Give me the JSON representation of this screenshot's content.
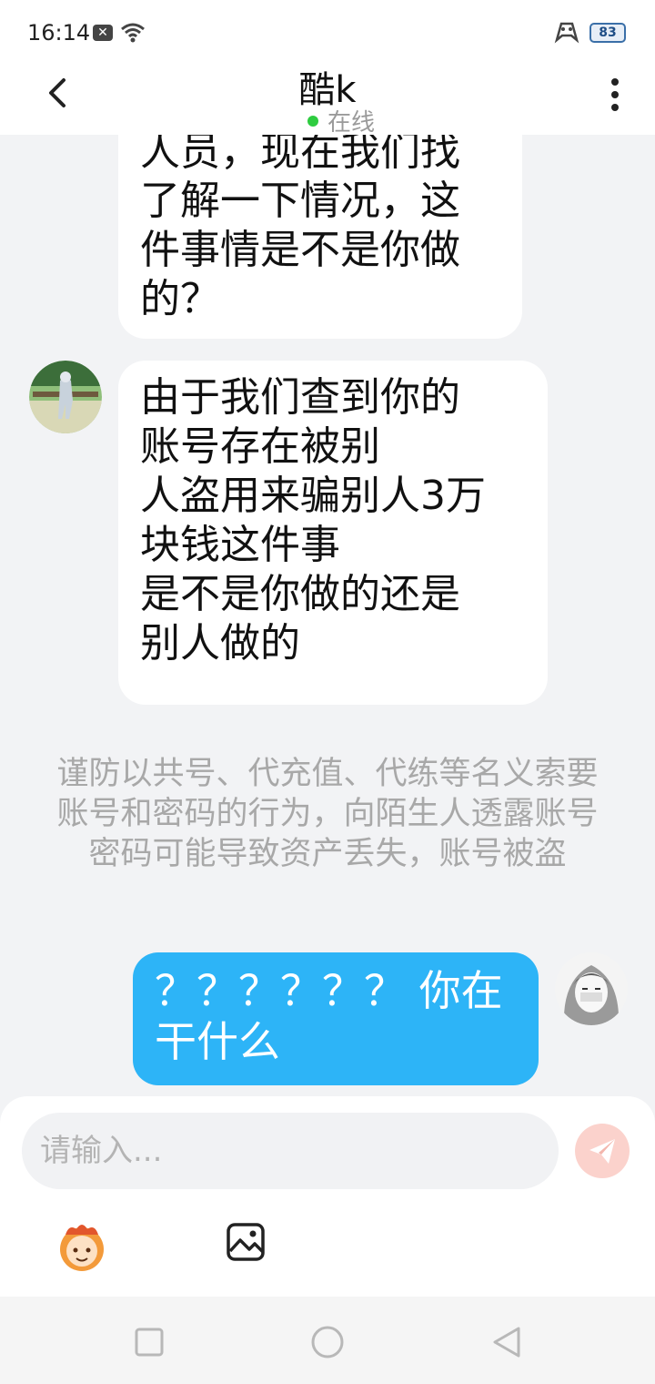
{
  "status_bar": {
    "time": "16:14",
    "battery": "83",
    "icons": [
      "notification-x-icon",
      "wifi-icon",
      "game-mode-icon",
      "battery-icon"
    ]
  },
  "header": {
    "title": "酷k",
    "status": "在线",
    "status_color": "#2ecc40"
  },
  "messages": [
    {
      "side": "left",
      "lines": [
        "人员，现在我们找",
        "了解一下情况，这",
        "件事情是不是你做",
        "的？"
      ]
    },
    {
      "side": "left",
      "lines": [
        "由于我们查到你的",
        "账号存在被别",
        "人盗用来骗别人3万",
        "块钱这件事",
        "是不是你做的还是",
        "别人做的"
      ]
    },
    {
      "side": "right",
      "lines": [
        "？？？？？？ 你在",
        "干什么"
      ]
    }
  ],
  "system_notice": "谨防以共号、代充值、代练等名义索要账号和密码的行为，向陌生人透露账号密码可能导致资产丢失，账号被盗",
  "composer": {
    "placeholder": "请输入..."
  },
  "colors": {
    "my_bubble": "#2db4f7",
    "other_bubble": "#ffffff",
    "background": "#f2f3f5",
    "send_button": "#fbd2cc"
  }
}
